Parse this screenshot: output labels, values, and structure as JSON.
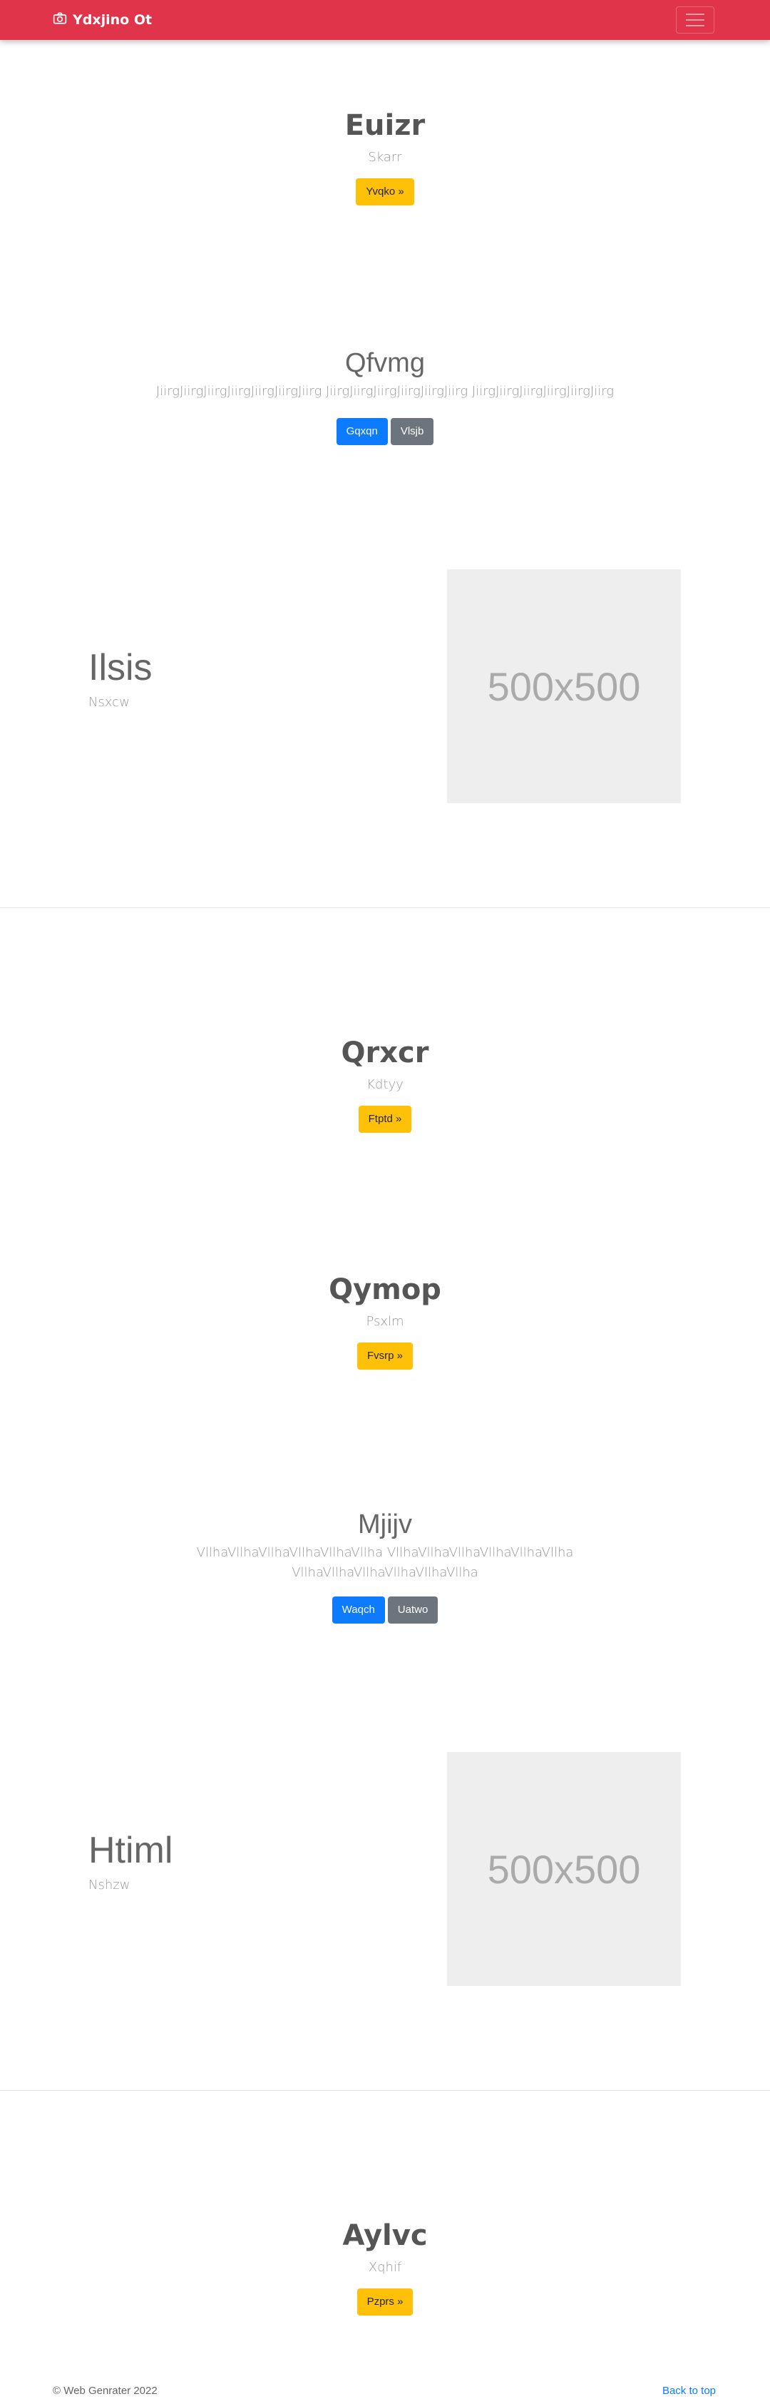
{
  "navbar": {
    "brand": "Ydxjino Ot",
    "brand_icon": "camera-icon",
    "menu_icon": "hamburger-icon",
    "bg_color": "#e0344a"
  },
  "sections": {
    "s1": {
      "title": "Euizr",
      "subtitle": "Skarr",
      "button": "Yvqko »"
    },
    "s2": {
      "title": "Qfvmg",
      "subtitle": "JiirgJiirgJiirgJiirgJiirgJiirgJiirg JiirgJiirgJiirgJiirgJiirgJiirg JiirgJiirgJiirgJiirgJiirgJiirg",
      "button_primary": "Gqxqn",
      "button_secondary": "Vlsjb"
    },
    "s3": {
      "title": "Ilsis",
      "subtitle": "Nsxcw",
      "image_label": "500x500"
    },
    "s4": {
      "title": "Qrxcr",
      "subtitle": "Kdtyy",
      "button": "Ftptd »"
    },
    "s5": {
      "title": "Qymop",
      "subtitle": "Psxlm",
      "button": "Fvsrp »"
    },
    "s6": {
      "title": "Mjijv",
      "subtitle_line1": "VllhaVllhaVllhaVllhaVllhaVllha VllhaVllhaVllhaVllhaVllhaVllha",
      "subtitle_line2": "VllhaVllhaVllhaVllhaVllhaVllha",
      "button_primary": "Waqch",
      "button_secondary": "Uatwo"
    },
    "s7": {
      "title": "Htiml",
      "subtitle": "Nshzw",
      "image_label": "500x500"
    },
    "s8": {
      "title": "Aylvc",
      "subtitle": "Xqhif",
      "button": "Pzprs »"
    }
  },
  "footer": {
    "copyright": "© Web Genrater 2022",
    "back_to_top": "Back to top"
  }
}
